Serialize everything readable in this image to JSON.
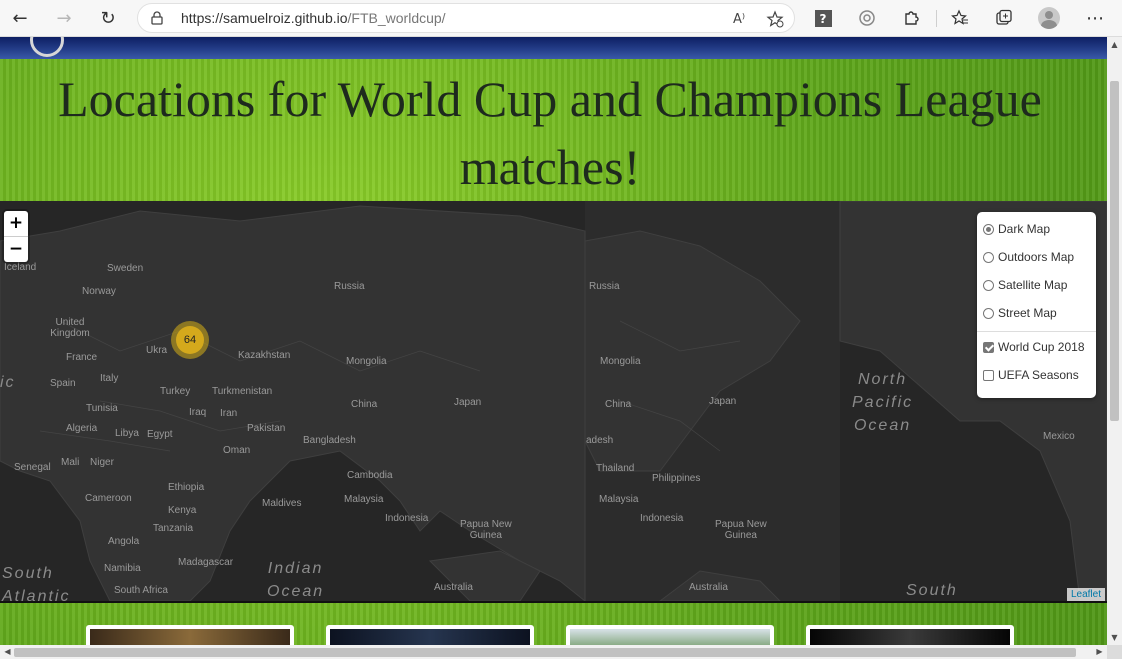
{
  "browser": {
    "url_host": "https://samuelroiz.github.io",
    "url_path": "/FTB_worldcup/",
    "read_aloud_label": "A⁾"
  },
  "page": {
    "title": "Locations for World Cup and Champions League matches!"
  },
  "map": {
    "zoom_in_label": "+",
    "zoom_out_label": "−",
    "cluster_count": "64",
    "attribution": "Leaflet",
    "labels": {
      "iceland": "Iceland",
      "sweden": "Sweden",
      "norway": "Norway",
      "united_kingdom": "United Kingdom",
      "france": "France",
      "spain": "Spain",
      "italy": "Italy",
      "ukraine": "Ukra",
      "kazakhstan": "Kazakhstan",
      "russia_1": "Russia",
      "russia_2": "Russia",
      "mongolia_1": "Mongolia",
      "mongolia_2": "Mongolia",
      "turkmenistan": "Turkmenistan",
      "turkey": "Turkey",
      "tunisia": "Tunisia",
      "iraq": "Iraq",
      "iran": "Iran",
      "algeria": "Algeria",
      "libya": "Libya",
      "egypt": "Egypt",
      "pakistan": "Pakistan",
      "china_1": "China",
      "china_2": "China",
      "japan_1": "Japan",
      "japan_2": "Japan",
      "bangladesh_1": "Bangladesh",
      "bangladesh_2": "adesh",
      "oman": "Oman",
      "mali": "Mali",
      "niger": "Niger",
      "senegal": "Senegal",
      "ethiopia": "Ethiopia",
      "cambodia": "Cambodia",
      "thailand": "Thailand",
      "philippines": "Philippines",
      "maldives": "Maldives",
      "malaysia_1": "Malaysia",
      "malaysia_2": "Malaysia",
      "cameroon": "Cameroon",
      "kenya": "Kenya",
      "tanzania": "Tanzania",
      "indonesia_1": "Indonesia",
      "indonesia_2": "Indonesia",
      "png_1": "Papua New\nGuinea",
      "png_2": "Papua New\nGuinea",
      "angola": "Angola",
      "namibia": "Namibia",
      "madagascar": "Madagascar",
      "south_africa": "South Africa",
      "australia_1": "Australia",
      "australia_2": "Australia",
      "mexico": "Mexico",
      "indian_ocean": "Indian\nOcean",
      "north_pacific": "North\nPacific\nOcean",
      "south_1": "South\nAtlantic",
      "south_2": "South",
      "atlantic_left": "ic"
    },
    "layers": {
      "base": [
        {
          "label": "Dark Map",
          "checked": true
        },
        {
          "label": "Outdoors Map",
          "checked": false
        },
        {
          "label": "Satellite Map",
          "checked": false
        },
        {
          "label": "Street Map",
          "checked": false
        }
      ],
      "overlays": [
        {
          "label": "World Cup 2018",
          "checked": true
        },
        {
          "label": "UEFA Seasons",
          "checked": false
        }
      ]
    }
  },
  "colors": {
    "map_bg": "#262626",
    "cluster": "#d4a91c",
    "grass": "#6fb51e"
  }
}
